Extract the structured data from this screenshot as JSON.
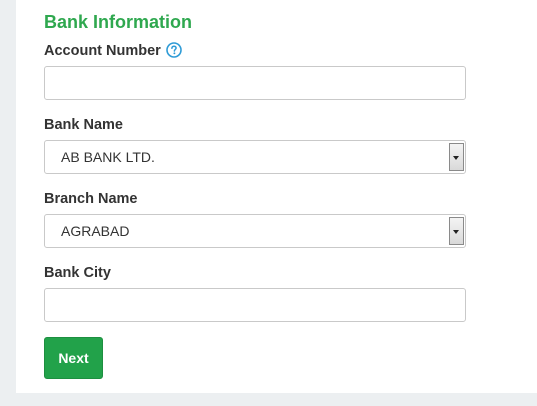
{
  "section": {
    "title": "Bank Information"
  },
  "fields": {
    "account_number": {
      "label": "Account Number",
      "value": "",
      "help_icon": "question-circle-icon"
    },
    "bank_name": {
      "label": "Bank Name",
      "selected": "AB BANK LTD."
    },
    "branch_name": {
      "label": "Branch Name",
      "selected": "AGRABAD"
    },
    "bank_city": {
      "label": "Bank City",
      "value": ""
    }
  },
  "actions": {
    "next_label": "Next"
  },
  "colors": {
    "accent": "#2fa84f",
    "button": "#22a24a",
    "help_icon": "#2e9bd6",
    "background": "#eceff1"
  }
}
